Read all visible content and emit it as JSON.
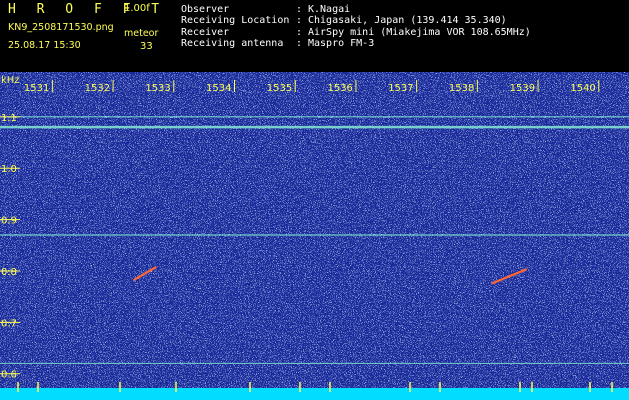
{
  "header": {
    "app_title": "H R O F F T",
    "version": "1.00f",
    "filename": "KN9_2508171530.png",
    "timestamp": "25.08.17 15:30",
    "meteor_label": "meteor",
    "meteor_count": "33",
    "info": [
      {
        "label": "Observer",
        "value": "K.Nagai"
      },
      {
        "label": "Receiving Location",
        "value": "Chigasaki, Japan (139.414 35.340)"
      },
      {
        "label": "Receiver",
        "value": "AirSpy mini (Miakejima VOR 108.65MHz)"
      },
      {
        "label": "Receiving antenna",
        "value": "Maspro FM-3"
      }
    ],
    "separator": ":"
  },
  "colors": {
    "background": "#000000",
    "header_accent": "#ffff55",
    "plot_blue": "#1a2a9a",
    "grid_text": "#ffff55",
    "signal_line": "#7fe0d0",
    "meteor_echo": "#ff6633",
    "bottom_bar": "#00ddff"
  },
  "chart_data": {
    "type": "heatmap",
    "y_unit": "kHz",
    "y_ticks": [
      "1.1",
      "1.0",
      "0.9",
      "0.8",
      "0.7",
      "0.6"
    ],
    "y_range": [
      0.58,
      1.16
    ],
    "x_ticks": [
      "1531",
      "1532",
      "1533",
      "1534",
      "1535",
      "1536",
      "1537",
      "1538",
      "1539",
      "1540"
    ],
    "x_range": [
      1530.5,
      1540.3
    ],
    "signal_lines_khz": [
      1.1,
      1.08,
      0.87,
      0.62
    ],
    "meteor_echoes": [
      {
        "x_start": 1532.35,
        "x_end": 1532.7,
        "y_start": 0.783,
        "y_end": 0.807
      },
      {
        "x_start": 1538.25,
        "x_end": 1538.8,
        "y_start": 0.776,
        "y_end": 0.803
      }
    ]
  }
}
